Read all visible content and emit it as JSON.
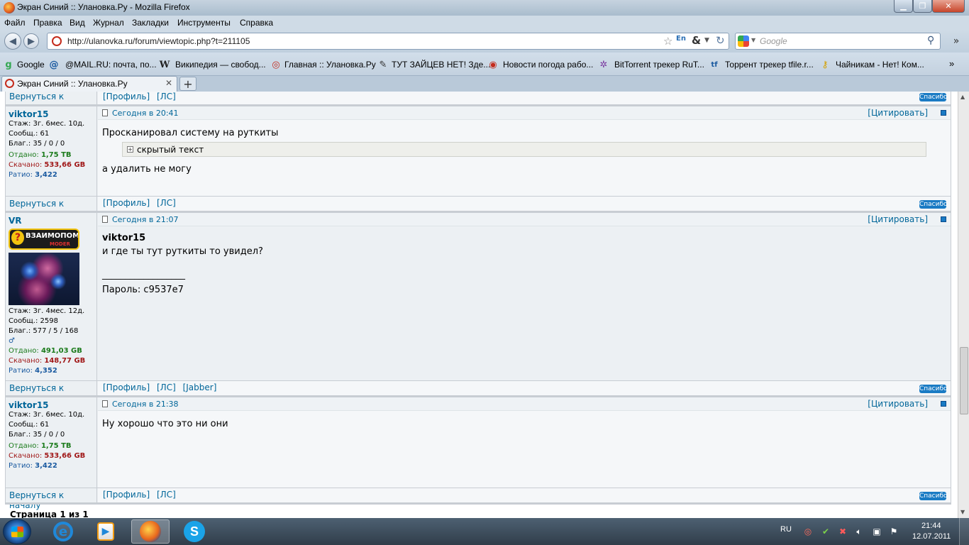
{
  "window": {
    "title": "Экран Синий :: Улановка.Ру - Mozilla Firefox"
  },
  "menu": [
    "Файл",
    "Правка",
    "Вид",
    "Журнал",
    "Закладки",
    "Инструменты",
    "Справка"
  ],
  "address": {
    "url": "http://ulanovka.ru/forum/viewtopic.php?t=211105",
    "lang_badge": "En"
  },
  "search": {
    "placeholder": "Google"
  },
  "bookmarks": [
    "Google",
    "@MAIL.RU: почта, по...",
    "Википедия — свобод...",
    "Главная :: Улановка.Ру",
    "ТУТ ЗАЙЦЕВ НЕТ! Зде...",
    "Новости погода рабо...",
    "BitTorrent трекер RuT...",
    "Торрент трекер tfile.r...",
    "Чайникам - Нет! Ком..."
  ],
  "tab": {
    "label": "Экран Синий :: Улановка.Ру"
  },
  "common": {
    "back_to_top": "Вернуться к началу",
    "profile": "[Профиль]",
    "pm": "[ЛС]",
    "jabber": "[Jabber]",
    "thanks": "Спасибо",
    "quote": "[Цитировать]",
    "spoiler": "скрытый текст",
    "pagination": "Страница 1 из 1"
  },
  "posts": [
    {
      "author": "viktor15",
      "stazh": "Стаж: 3г. 6мес. 10д.",
      "soobsh": "Сообщ.: 61",
      "blag": "Благ.: 35 / 0 / 0",
      "otdano_label": "Отдано: ",
      "otdano": "1,75 TB",
      "skachano_label": "Скачано: ",
      "skachano": "533,66 GB",
      "ratio_label": "Ратио: ",
      "ratio": "3,422",
      "date": "Сегодня в 20:41",
      "text1": "Просканировал систему на руткиты",
      "text2": "а удалить не могу"
    },
    {
      "author": "VR",
      "rank_title": "ВЗАИМОПОМОЩЬ",
      "rank_sub": "MODER",
      "stazh": "Стаж: 3г. 4мес. 12д.",
      "soobsh": "Сообщ.: 2598",
      "blag": "Благ.: 577 / 5 / 168",
      "otdano_label": "Отдано: ",
      "otdano": "491,03 GB",
      "skachano_label": "Скачано: ",
      "skachano": "148,77 GB",
      "ratio_label": "Ратио: ",
      "ratio": "4,352",
      "date": "Сегодня в 21:07",
      "reply_to": "viktor15",
      "text1": "и где ты тут руткиты то увидел?",
      "signature_rule": "__________________",
      "signature": "Пароль: c9537e7"
    },
    {
      "author": "viktor15",
      "stazh": "Стаж: 3г. 6мес. 10д.",
      "soobsh": "Сообщ.: 61",
      "blag": "Благ.: 35 / 0 / 0",
      "otdano_label": "Отдано: ",
      "otdano": "1,75 TB",
      "skachano_label": "Скачано: ",
      "skachano": "533,66 GB",
      "ratio_label": "Ратио: ",
      "ratio": "3,422",
      "date": "Сегодня в 21:38",
      "text1": "Ну хорошо что это ни они"
    }
  ],
  "taskbar": {
    "lang": "RU",
    "time": "21:44",
    "date": "12.07.2011"
  }
}
